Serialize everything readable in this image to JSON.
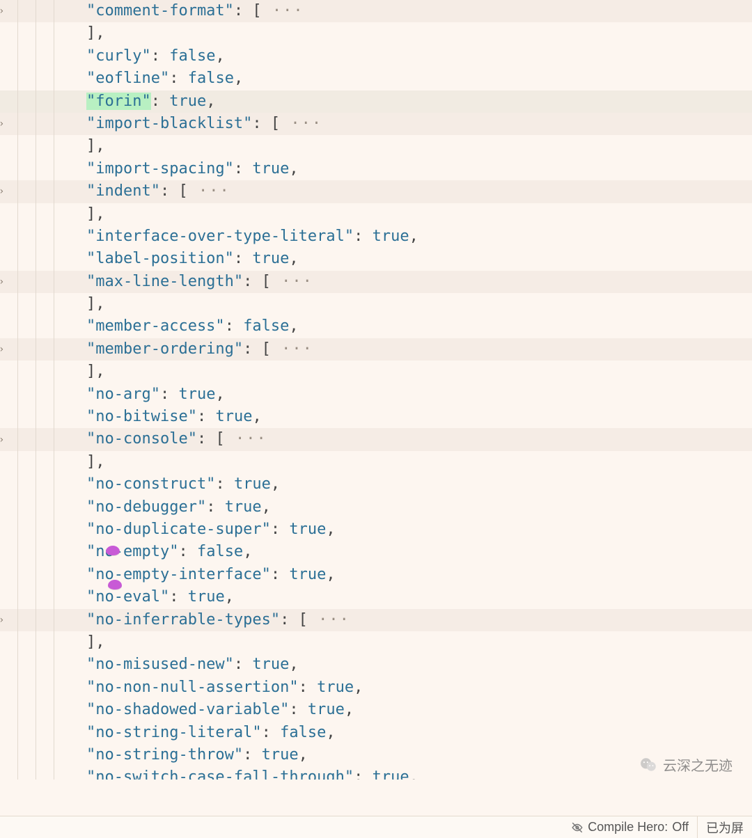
{
  "editor": {
    "folded_marker": "···",
    "lines": [
      {
        "type": "kv_open",
        "key": "comment-format",
        "fold": true
      },
      {
        "type": "close_arr"
      },
      {
        "type": "kv_bool",
        "key": "curly",
        "value": "false"
      },
      {
        "type": "kv_bool",
        "key": "eofline",
        "value": "false"
      },
      {
        "type": "kv_bool",
        "key": "forin",
        "value": "true",
        "highlight_key": true,
        "row_hl": true
      },
      {
        "type": "kv_open",
        "key": "import-blacklist",
        "fold": true
      },
      {
        "type": "close_arr"
      },
      {
        "type": "kv_bool",
        "key": "import-spacing",
        "value": "true"
      },
      {
        "type": "kv_open",
        "key": "indent",
        "fold": true
      },
      {
        "type": "close_arr"
      },
      {
        "type": "kv_bool",
        "key": "interface-over-type-literal",
        "value": "true"
      },
      {
        "type": "kv_bool",
        "key": "label-position",
        "value": "true"
      },
      {
        "type": "kv_open",
        "key": "max-line-length",
        "fold": true
      },
      {
        "type": "close_arr"
      },
      {
        "type": "kv_bool",
        "key": "member-access",
        "value": "false"
      },
      {
        "type": "kv_open",
        "key": "member-ordering",
        "fold": true
      },
      {
        "type": "close_arr"
      },
      {
        "type": "kv_bool",
        "key": "no-arg",
        "value": "true"
      },
      {
        "type": "kv_bool",
        "key": "no-bitwise",
        "value": "true"
      },
      {
        "type": "kv_open",
        "key": "no-console",
        "fold": true
      },
      {
        "type": "close_arr"
      },
      {
        "type": "kv_bool",
        "key": "no-construct",
        "value": "true"
      },
      {
        "type": "kv_bool",
        "key": "no-debugger",
        "value": "true"
      },
      {
        "type": "kv_bool",
        "key": "no-duplicate-super",
        "value": "true"
      },
      {
        "type": "kv_bool",
        "key": "no-empty",
        "value": "false"
      },
      {
        "type": "kv_bool",
        "key": "no-empty-interface",
        "value": "true"
      },
      {
        "type": "kv_bool",
        "key": "no-eval",
        "value": "true"
      },
      {
        "type": "kv_open",
        "key": "no-inferrable-types",
        "fold": true
      },
      {
        "type": "close_arr"
      },
      {
        "type": "kv_bool",
        "key": "no-misused-new",
        "value": "true"
      },
      {
        "type": "kv_bool",
        "key": "no-non-null-assertion",
        "value": "true"
      },
      {
        "type": "kv_bool",
        "key": "no-shadowed-variable",
        "value": "true"
      },
      {
        "type": "kv_bool",
        "key": "no-string-literal",
        "value": "false"
      },
      {
        "type": "kv_bool",
        "key": "no-string-throw",
        "value": "true"
      },
      {
        "type": "kv_bool",
        "key": "no-switch-case-fall-through",
        "value": "true",
        "last": true
      }
    ]
  },
  "watermark": {
    "text": "云深之无迹"
  },
  "statusbar": {
    "compile_hero_label": "Compile Hero:",
    "compile_hero_state": "Off",
    "screen_label": "已为屏"
  },
  "colors": {
    "key": "#2b6f95",
    "bool": "#2b6f95",
    "bg": "#fdf6f0",
    "fold_bg": "#f5ece5"
  }
}
